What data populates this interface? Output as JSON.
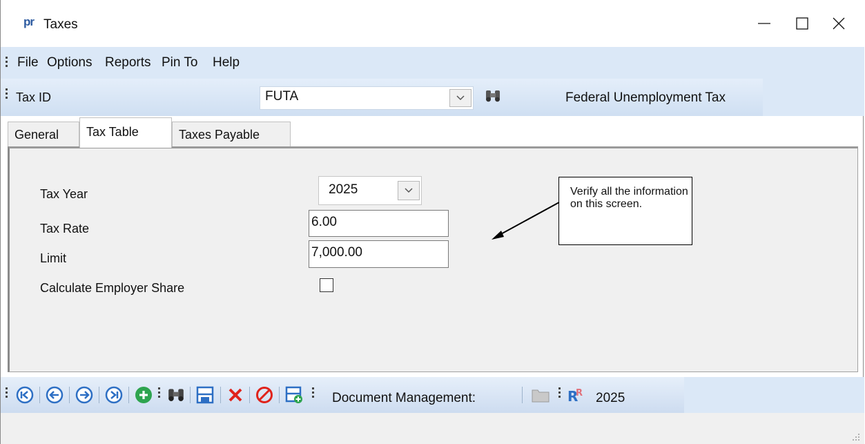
{
  "window": {
    "logo": "pr",
    "title": "Taxes"
  },
  "menu": {
    "items": [
      "File",
      "Options",
      "Reports",
      "Pin To",
      "Help"
    ]
  },
  "tax_id_bar": {
    "label": "Tax ID",
    "value": "FUTA",
    "description": "Federal Unemployment Tax"
  },
  "tabs": {
    "items": [
      "General",
      "Tax Table",
      "Taxes Payable"
    ],
    "active": "Tax Table"
  },
  "form": {
    "tax_year_label": "Tax Year",
    "tax_year_value": "2025",
    "tax_rate_label": "Tax Rate",
    "tax_rate_value": "6.00",
    "limit_label": "Limit",
    "limit_value": "7,000.00",
    "employer_share_label": "Calculate Employer Share",
    "employer_share_checked": false
  },
  "callout": {
    "text": "Verify all the information on this screen."
  },
  "toolbar": {
    "icons": [
      "first-record-icon",
      "previous-record-icon",
      "next-record-icon",
      "last-record-icon",
      "add-icon",
      "find-icon",
      "save-icon",
      "delete-icon",
      "cancel-icon",
      "save-new-icon",
      "folder-icon",
      "report-icon"
    ],
    "doc_mgmt_label": "Document Management:",
    "year": "2025"
  },
  "colors": {
    "menu_bg": "#dbe8f7",
    "accent_blue": "#2d6fc4",
    "delete_red": "#e0231b",
    "add_green": "#2ea44f"
  }
}
